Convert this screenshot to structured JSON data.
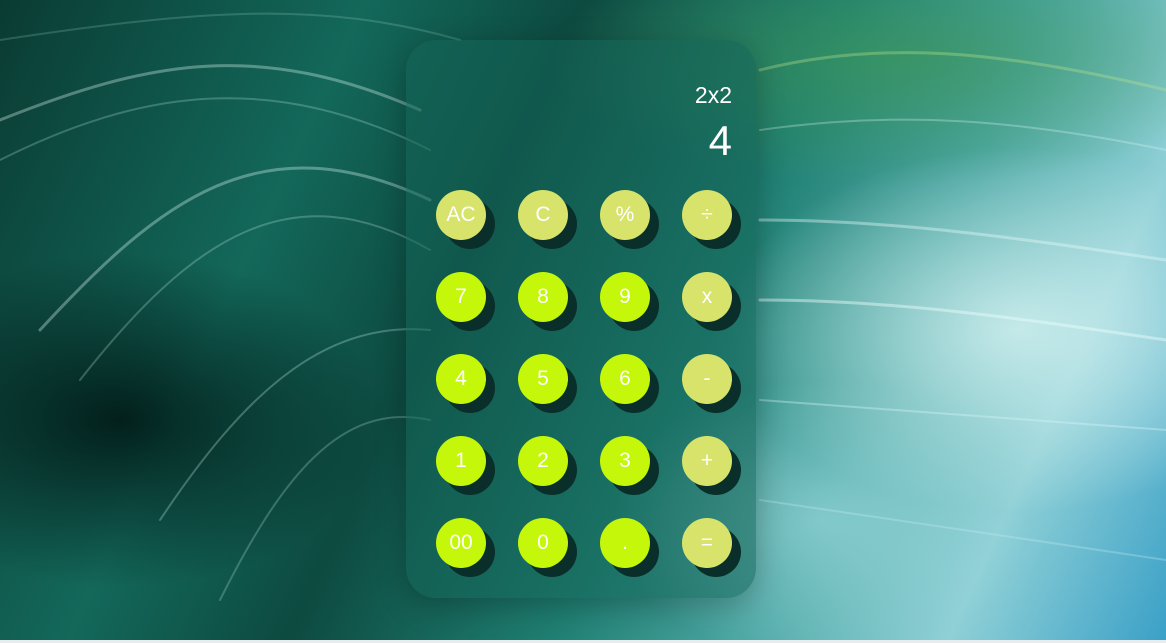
{
  "display": {
    "expression": "2x2",
    "result": "4"
  },
  "keys": [
    {
      "label": "AC",
      "kind": "fn"
    },
    {
      "label": "C",
      "kind": "fn"
    },
    {
      "label": "%",
      "kind": "fn"
    },
    {
      "label": "÷",
      "kind": "fn"
    },
    {
      "label": "7",
      "kind": "num"
    },
    {
      "label": "8",
      "kind": "num"
    },
    {
      "label": "9",
      "kind": "num"
    },
    {
      "label": "x",
      "kind": "fn"
    },
    {
      "label": "4",
      "kind": "num"
    },
    {
      "label": "5",
      "kind": "num"
    },
    {
      "label": "6",
      "kind": "num"
    },
    {
      "label": "-",
      "kind": "fn"
    },
    {
      "label": "1",
      "kind": "num"
    },
    {
      "label": "2",
      "kind": "num"
    },
    {
      "label": "3",
      "kind": "num"
    },
    {
      "label": "+",
      "kind": "fn"
    },
    {
      "label": "00",
      "kind": "num"
    },
    {
      "label": "0",
      "kind": "num"
    },
    {
      "label": ".",
      "kind": "num"
    },
    {
      "label": "=",
      "kind": "fn"
    }
  ],
  "colors": {
    "function_key": "#d7e36b",
    "number_key": "#c4f70a",
    "key_shadow": "#0a2f2a",
    "text": "#ffffff"
  }
}
